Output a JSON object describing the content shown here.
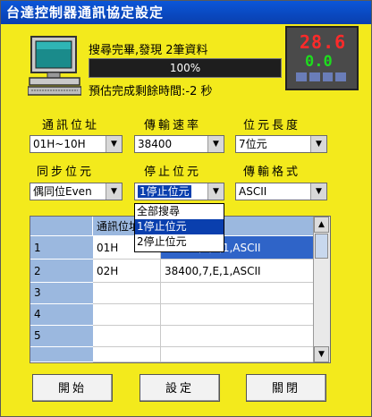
{
  "window": {
    "title": "台達控制器通訊協定設定"
  },
  "status": {
    "search_result": "搜尋完畢,發現 2筆資料",
    "progress": 1.0,
    "progress_text": "100%",
    "remaining": "預估完成剩餘時間:-2 秒"
  },
  "controller": {
    "pv": "28.6",
    "sv": "0.0"
  },
  "settings": {
    "address_label": "通訊位址",
    "address_value": "01H~10H",
    "baud_label": "傳輸速率",
    "baud_value": "38400",
    "bits_label": "位元長度",
    "bits_value": "7位元",
    "parity_label": "同步位元",
    "parity_value": "偶同位Even",
    "stop_label": "停止位元",
    "stop_value": "1停止位元",
    "format_label": "傳輸格式",
    "format_value": "ASCII"
  },
  "stop_dropdown": {
    "options": [
      "全部搜尋",
      "1停止位元",
      "2停止位元"
    ],
    "highlighted": 1
  },
  "table": {
    "columns": [
      "通訊位址",
      ""
    ],
    "rows": [
      {
        "num": "1",
        "addr": "01H",
        "params": "38400,7,E,1,ASCII"
      },
      {
        "num": "2",
        "addr": "02H",
        "params": "38400,7,E,1,ASCII"
      },
      {
        "num": "3",
        "addr": "",
        "params": ""
      },
      {
        "num": "4",
        "addr": "",
        "params": ""
      },
      {
        "num": "5",
        "addr": "",
        "params": ""
      }
    ]
  },
  "buttons": {
    "start": "開始",
    "set": "設定",
    "close": "關閉"
  },
  "colors": {
    "window_bg": "#f3ea1c",
    "title_bg": "#0b56d8",
    "selection": "#0a3fae",
    "grid_header": "#9bb8df"
  }
}
